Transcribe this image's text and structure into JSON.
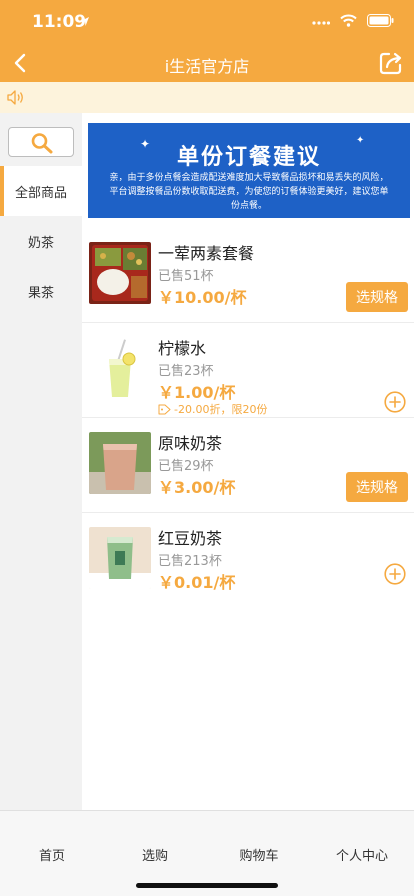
{
  "status_bar": {
    "time": "11:09"
  },
  "nav": {
    "title": "i生活官方店"
  },
  "sidebar": {
    "categories": [
      {
        "label": "全部商品",
        "active": true
      },
      {
        "label": "奶茶",
        "active": false
      },
      {
        "label": "果茶",
        "active": false
      }
    ]
  },
  "banner": {
    "title": "单份订餐建议",
    "text": "亲，由于多份点餐会造成配送难度加大导致餐品损坏和易丢失的风险，平台调整按餐品份数收取配送费，为使您的订餐体验更美好，建议您单份点餐。"
  },
  "products": [
    {
      "name": "一荤两素套餐",
      "sold": "已售51杯",
      "price": "￥10.00/杯",
      "action": "选规格"
    },
    {
      "name": "柠檬水",
      "sold": "已售23杯",
      "price": "￥1.00/杯",
      "promo": "-20.00折，限20份"
    },
    {
      "name": "原味奶茶",
      "sold": "已售29杯",
      "price": "￥3.00/杯",
      "action": "选规格"
    },
    {
      "name": "红豆奶茶",
      "sold": "已售213杯",
      "price": "￥0.01/杯"
    }
  ],
  "tabbar": {
    "tabs": [
      {
        "label": "首页"
      },
      {
        "label": "选购"
      },
      {
        "label": "购物车"
      },
      {
        "label": "个人中心"
      }
    ]
  },
  "colors": {
    "accent": "#f5a940",
    "banner": "#1e61c6",
    "notice_bg": "#fdf3dc"
  }
}
